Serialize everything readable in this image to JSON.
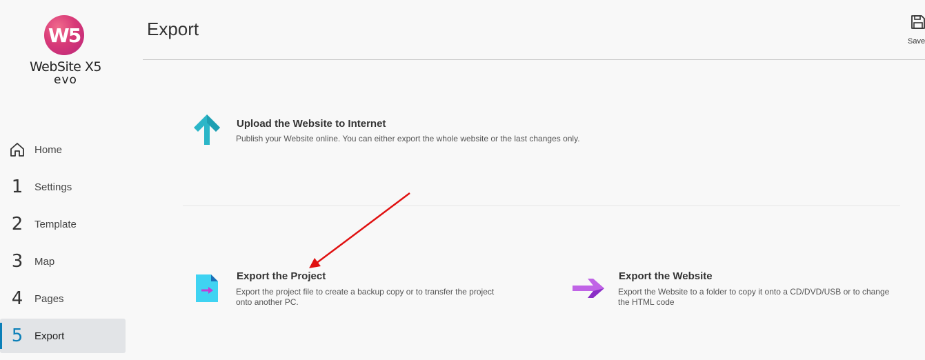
{
  "brand": {
    "badge": "W5",
    "name": "WebSite X5",
    "edition": "evo"
  },
  "nav": {
    "items": [
      {
        "num": "",
        "label": "Home",
        "icon": "home-icon"
      },
      {
        "num": "1",
        "label": "Settings"
      },
      {
        "num": "2",
        "label": "Template"
      },
      {
        "num": "3",
        "label": "Map"
      },
      {
        "num": "4",
        "label": "Pages"
      },
      {
        "num": "5",
        "label": "Export",
        "active": true
      }
    ],
    "accent": "#0b7fb8"
  },
  "header": {
    "title": "Export",
    "save_label": "Save"
  },
  "options": {
    "upload": {
      "title": "Upload the Website to Internet",
      "desc": "Publish your Website online. You can either export the whole website or the last changes only.",
      "icon": "upload-arrow-icon",
      "color": "#2bb6c8"
    },
    "project": {
      "title": "Export the Project",
      "desc_line1": "Export the project file to create a backup copy or to transfer the project",
      "desc_line2": "onto another PC.",
      "icon": "project-file-icon",
      "color": "#3fd3f2"
    },
    "website": {
      "title": "Export the Website",
      "desc_line1": "Export the Website to a folder to copy it onto a CD/DVD/USB or to change",
      "desc_line2": "the HTML code",
      "icon": "export-arrow-icon",
      "color": "#b058e0"
    }
  },
  "annotation": {
    "color": "#e01010",
    "icon": "red-annotation-arrow"
  }
}
